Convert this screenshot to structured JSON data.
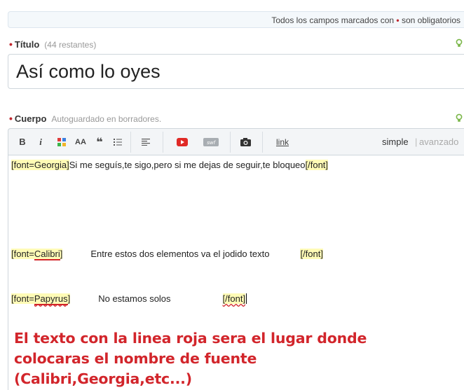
{
  "notice": {
    "text_before": "Todos los campos marcados con ",
    "dot": "•",
    "text_after": " son obligatorios"
  },
  "title_field": {
    "required_mark": "•",
    "label": "Título",
    "hint": "(44 restantes)",
    "value": "Así como lo oyes"
  },
  "body_field": {
    "required_mark": "•",
    "label": "Cuerpo",
    "hint": "Autoguardado en borradores."
  },
  "toolbar": {
    "bold": "B",
    "italic": "i",
    "font_size": "AA",
    "quote": "❝",
    "link": "link",
    "mode_simple": "simple",
    "mode_sep": "|",
    "mode_advanced": "avanzado"
  },
  "editor": {
    "line1": {
      "open_tag": "[font=Georgia]",
      "text": "Si me seguís,te sigo,pero si me dejas de seguir,te bloqueo",
      "close_tag": "[/font]"
    },
    "line2": {
      "tag_prefix": "[font=",
      "font": "Calibri",
      "tag_suffix": "]",
      "text": "Entre estos dos elementos va el jodido texto",
      "close_tag": "[/font]"
    },
    "line3": {
      "tag_prefix": "[font=",
      "font": "Papyrus",
      "tag_suffix": "]",
      "text": "No estamos solos",
      "close_tag": "[/font]"
    },
    "note": "El texto con la linea roja sera el lugar donde colocaras el nombre de fuente (Calibri,Georgia,etc...)"
  },
  "colors": {
    "required": "#c0262d",
    "highlight": "#fffbb6",
    "annotation": "#d2252b",
    "youtube": "#e02a26",
    "bulb": "#7ab648"
  }
}
